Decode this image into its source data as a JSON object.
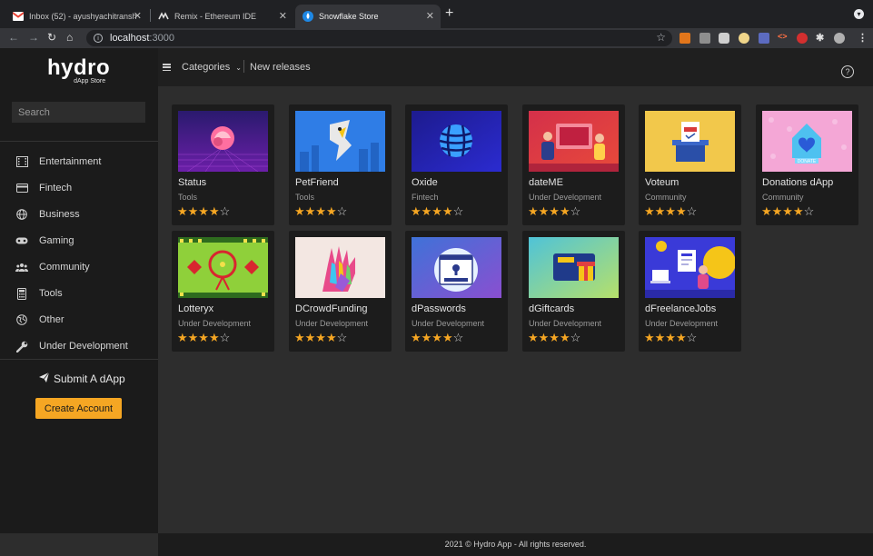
{
  "browser": {
    "tabs": [
      {
        "title": "Inbox (52) - ayushyachitransh",
        "icon": "gmail-icon"
      },
      {
        "title": "Remix - Ethereum IDE",
        "icon": "remix-icon"
      },
      {
        "title": "Snowflake Store",
        "icon": "snowflake-icon"
      }
    ],
    "url_host": "localhost",
    "url_port": ":3000"
  },
  "sidebar": {
    "logo_main": "hydro",
    "logo_sub": "dApp Store",
    "search_placeholder": "Search",
    "items": [
      {
        "label": "Entertainment",
        "icon": "film-icon"
      },
      {
        "label": "Fintech",
        "icon": "card-icon"
      },
      {
        "label": "Business",
        "icon": "globe-icon"
      },
      {
        "label": "Gaming",
        "icon": "gamepad-icon"
      },
      {
        "label": "Community",
        "icon": "people-icon"
      },
      {
        "label": "Tools",
        "icon": "calculator-icon"
      },
      {
        "label": "Other",
        "icon": "globe-alt-icon"
      },
      {
        "label": "Under Development",
        "icon": "wrench-icon"
      }
    ],
    "submit_label": "Submit A dApp",
    "create_account_label": "Create Account"
  },
  "topbar": {
    "categories_label": "Categories",
    "new_releases_label": "New releases",
    "help_label": "?"
  },
  "apps": [
    {
      "name": "Status",
      "category": "Tools",
      "rating": 4
    },
    {
      "name": "PetFriend",
      "category": "Tools",
      "rating": 4
    },
    {
      "name": "Oxide",
      "category": "Fintech",
      "rating": 4
    },
    {
      "name": "dateME",
      "category": "Under Development",
      "rating": 4
    },
    {
      "name": "Voteum",
      "category": "Community",
      "rating": 4
    },
    {
      "name": "Donations dApp",
      "category": "Community",
      "rating": 4
    },
    {
      "name": "Lotteryx",
      "category": "Under Development",
      "rating": 4
    },
    {
      "name": "DCrowdFunding",
      "category": "Under Development",
      "rating": 4
    },
    {
      "name": "dPasswords",
      "category": "Under Development",
      "rating": 4
    },
    {
      "name": "dGiftcards",
      "category": "Under Development",
      "rating": 4
    },
    {
      "name": "dFreelanceJobs",
      "category": "Under Development",
      "rating": 4
    }
  ],
  "footer": {
    "text": "2021 © Hydro App - All rights reserved."
  },
  "colors": {
    "accent": "#f5a623",
    "sidebar_bg": "#1b1b1b",
    "content_bg": "#2d2d2d",
    "card_bg": "#1c1c1c"
  }
}
